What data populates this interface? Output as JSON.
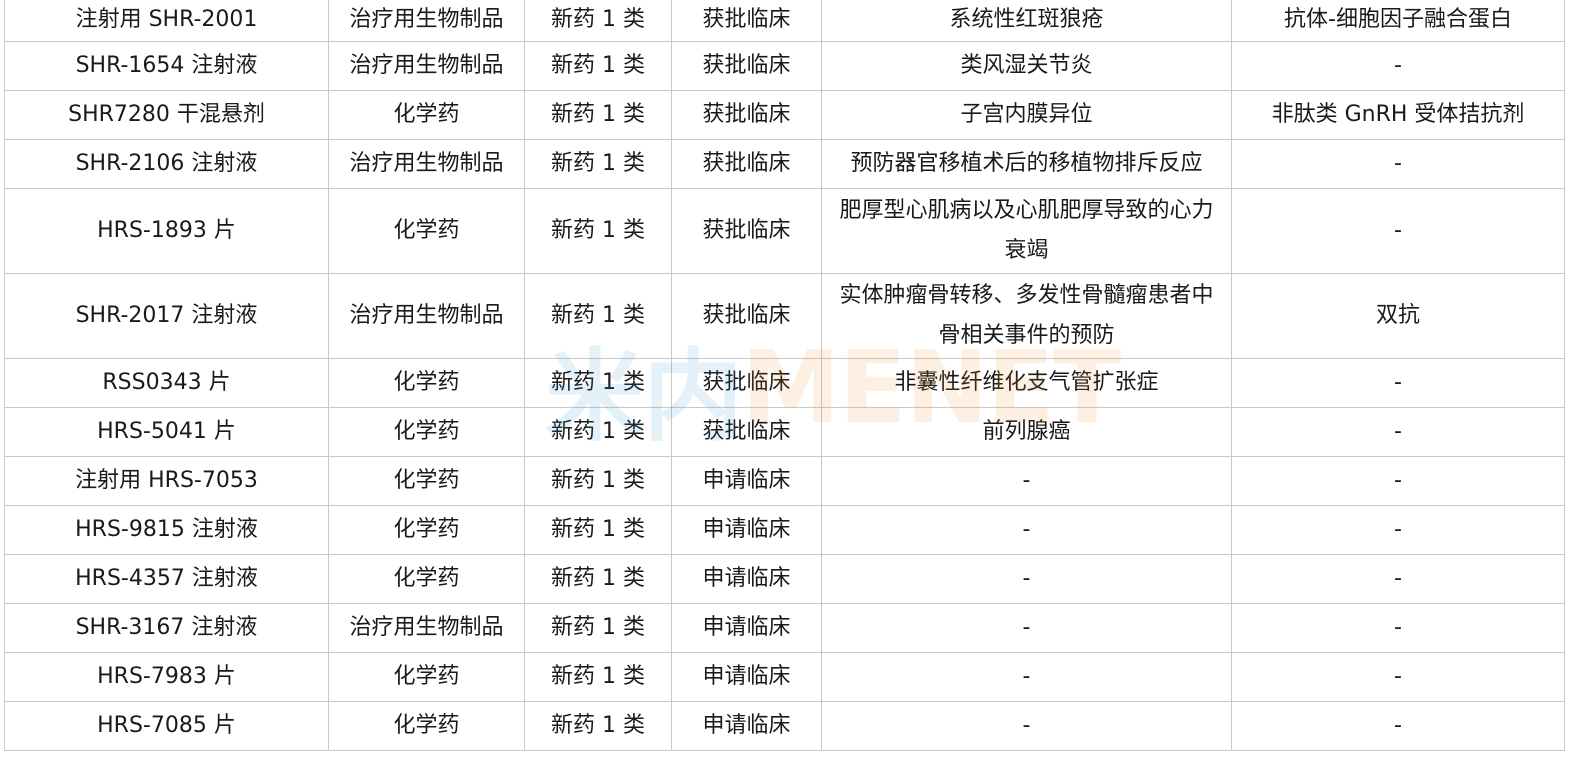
{
  "table": {
    "rows": [
      [
        "注射用 SHR-2001",
        "治疗用生物制品",
        "新药 1 类",
        "获批临床",
        "系统性红斑狼疮",
        "抗体-细胞因子融合蛋白"
      ],
      [
        "SHR-1654 注射液",
        "治疗用生物制品",
        "新药 1 类",
        "获批临床",
        "类风湿关节炎",
        "-"
      ],
      [
        "SHR7280 干混悬剂",
        "化学药",
        "新药 1 类",
        "获批临床",
        "子宫内膜异位",
        "非肽类 GnRH 受体拮抗剂"
      ],
      [
        "SHR-2106 注射液",
        "治疗用生物制品",
        "新药 1 类",
        "获批临床",
        "预防器官移植术后的移植物排斥反应",
        "-"
      ],
      [
        "HRS-1893 片",
        "化学药",
        "新药 1 类",
        "获批临床",
        "肥厚型心肌病以及心肌肥厚导致的心力衰竭",
        "-"
      ],
      [
        "SHR-2017 注射液",
        "治疗用生物制品",
        "新药 1 类",
        "获批临床",
        "实体肿瘤骨转移、多发性骨髓瘤患者中骨相关事件的预防",
        "双抗"
      ],
      [
        "RSS0343 片",
        "化学药",
        "新药 1 类",
        "获批临床",
        "非囊性纤维化支气管扩张症",
        "-"
      ],
      [
        "HRS-5041 片",
        "化学药",
        "新药 1 类",
        "获批临床",
        "前列腺癌",
        "-"
      ],
      [
        "注射用 HRS-7053",
        "化学药",
        "新药 1 类",
        "申请临床",
        "-",
        "-"
      ],
      [
        "HRS-9815 注射液",
        "化学药",
        "新药 1 类",
        "申请临床",
        "-",
        "-"
      ],
      [
        "HRS-4357 注射液",
        "化学药",
        "新药 1 类",
        "申请临床",
        "-",
        "-"
      ],
      [
        "SHR-3167 注射液",
        "治疗用生物制品",
        "新药 1 类",
        "申请临床",
        "-",
        "-"
      ],
      [
        "HRS-7983 片",
        "化学药",
        "新药 1 类",
        "申请临床",
        "-",
        "-"
      ],
      [
        "HRS-7085 片",
        "化学药",
        "新药 1 类",
        "申请临床",
        "-",
        "-"
      ]
    ]
  },
  "watermark": {
    "left_text": "米内",
    "right_text": "MENET",
    "left_color": "#2b8fc9",
    "right_color": "#f08a24"
  }
}
